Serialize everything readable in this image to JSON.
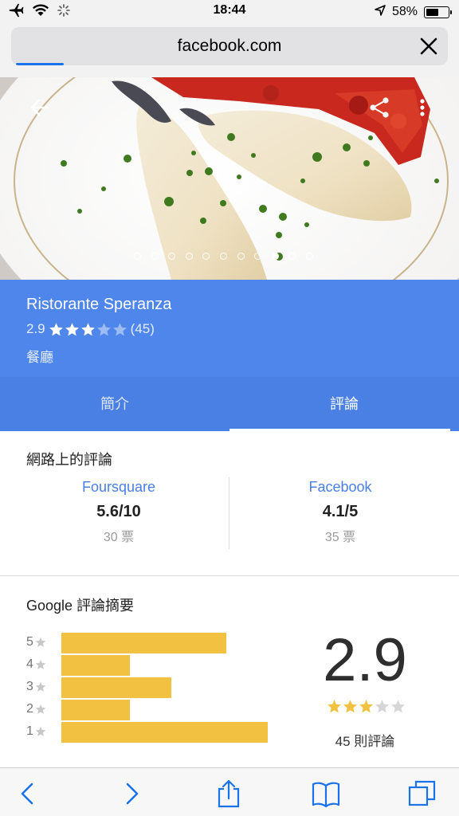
{
  "status_bar": {
    "time": "18:44",
    "battery_percent": "58%",
    "battery_level": 0.58,
    "icons": [
      "airplane-icon",
      "wifi-icon",
      "loading-spinner-icon",
      "location-arrow-icon",
      "battery-icon"
    ]
  },
  "browser": {
    "url": "facebook.com",
    "load_progress": 0.11
  },
  "hero": {
    "photo_count": 11,
    "active_photo_index": 8
  },
  "place": {
    "name": "Ristorante Speranza",
    "rating": "2.9",
    "stars": 3,
    "review_count": "(45)",
    "type": "餐廳"
  },
  "tabs": [
    {
      "label": "簡介",
      "active": false
    },
    {
      "label": "評論",
      "active": true
    }
  ],
  "web_reviews": {
    "title": "網路上的評論",
    "sources": [
      {
        "name": "Foursquare",
        "score": "5.6/10",
        "votes": "30 票"
      },
      {
        "name": "Facebook",
        "score": "4.1/5",
        "votes": "35 票"
      }
    ]
  },
  "summary": {
    "title": "Google 評論摘要",
    "score": "2.9",
    "stars": 3,
    "count": "45 則評論",
    "bars": [
      {
        "label": "5",
        "fraction": 0.72
      },
      {
        "label": "4",
        "fraction": 0.3
      },
      {
        "label": "3",
        "fraction": 0.48
      },
      {
        "label": "2",
        "fraction": 0.3
      },
      {
        "label": "1",
        "fraction": 0.9
      }
    ]
  },
  "colors": {
    "header_blue": "#4f86ec",
    "tab_blue": "#4a7fe3",
    "bar_yellow": "#f2c142",
    "ios_blue": "#1a73e8"
  }
}
